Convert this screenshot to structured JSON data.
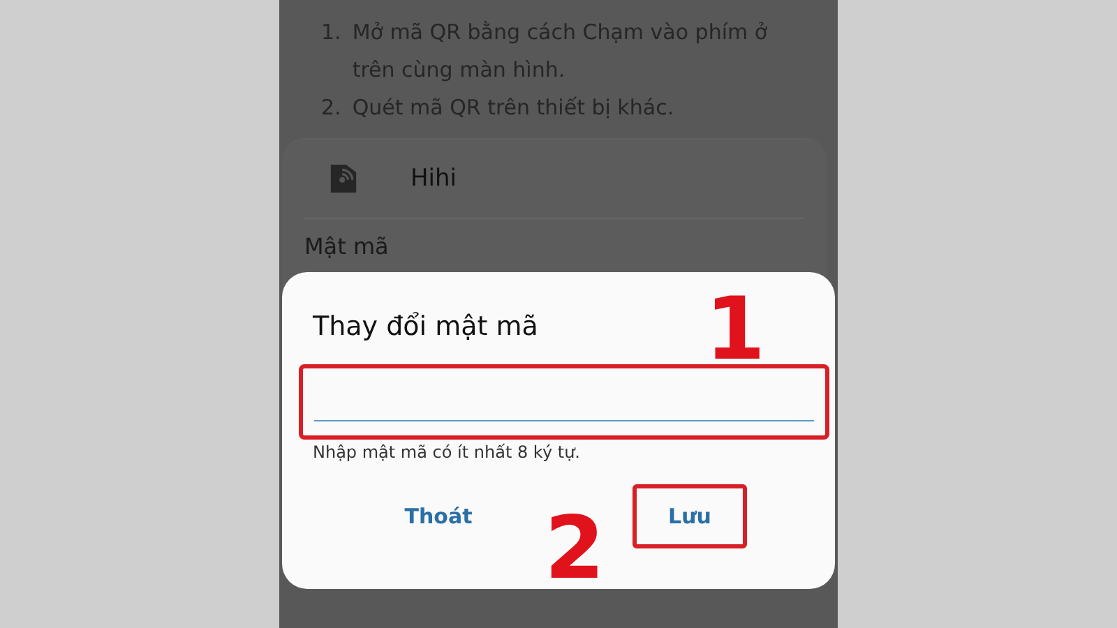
{
  "instructions": [
    {
      "number": "1.",
      "text": "Mở mã QR bằng cách Chạm vào phím ở trên cùng màn hình."
    },
    {
      "number": "2.",
      "text": "Quét mã QR trên thiết bị khác."
    }
  ],
  "network": {
    "name": "Hihi"
  },
  "password_label": "Mật mã",
  "dialog": {
    "title": "Thay đổi mật mã",
    "field": {
      "highlighted": true
    },
    "hint": "Nhập mật mã có ít nhất 8 ký tự.",
    "buttons": [
      {
        "label": "Thoát",
        "highlighted": false
      },
      {
        "label": "Lưu",
        "highlighted": true
      }
    ]
  },
  "annotations": [
    {
      "label": "1"
    },
    {
      "label": "2"
    }
  ]
}
